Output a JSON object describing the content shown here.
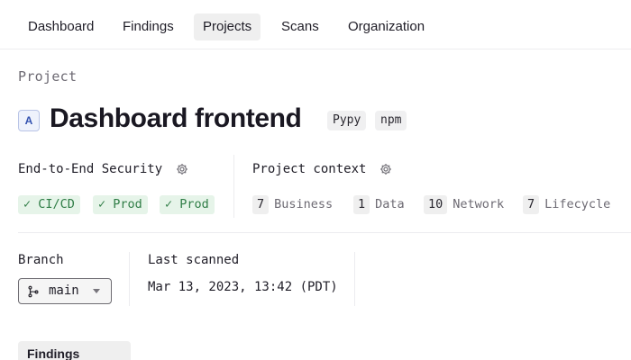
{
  "nav": {
    "tabs": [
      {
        "label": "Dashboard"
      },
      {
        "label": "Findings"
      },
      {
        "label": "Projects",
        "active": true
      },
      {
        "label": "Scans"
      },
      {
        "label": "Organization"
      }
    ]
  },
  "project": {
    "eyebrow": "Project",
    "icon_letter": "A",
    "title": "Dashboard frontend",
    "tags": [
      "Pypy",
      "npm"
    ]
  },
  "security": {
    "label": "End-to-End Security",
    "pills": [
      "✓ CI/CD",
      "✓ Prod",
      "✓ Prod"
    ]
  },
  "context": {
    "label": "Project context",
    "items": [
      {
        "count": "7",
        "label": "Business"
      },
      {
        "count": "1",
        "label": "Data"
      },
      {
        "count": "10",
        "label": "Network"
      },
      {
        "count": "7",
        "label": "Lifecycle"
      }
    ]
  },
  "branch": {
    "label": "Branch",
    "value": "main"
  },
  "last_scanned": {
    "label": "Last scanned",
    "value": "Mar 13, 2023, 13:42 (PDT)"
  },
  "findings_tab": {
    "label": "Findings"
  },
  "colors": {
    "accent_green": "#2f7d46",
    "pill_green_bg": "#e6f4e9",
    "icon_blue": "#3352b0"
  },
  "icons": {
    "gear": "gear-icon",
    "branch": "git-branch-icon",
    "caret": "chevron-down-icon"
  }
}
